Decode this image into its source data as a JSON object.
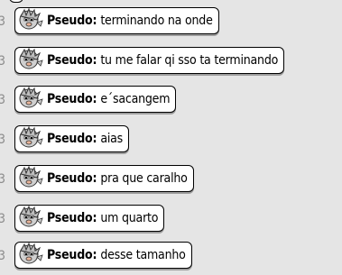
{
  "chat": {
    "messages": [
      {
        "left_mark": "3",
        "sender": "Pseudo:",
        "text": "terminando na onde"
      },
      {
        "left_mark": "3",
        "sender": "Pseudo:",
        "text": "tu me falar qi sso ta terminando"
      },
      {
        "left_mark": "3",
        "sender": "Pseudo:",
        "text": "e´sacangem"
      },
      {
        "left_mark": "3",
        "sender": "Pseudo:",
        "text": "aias"
      },
      {
        "left_mark": "3",
        "sender": "Pseudo:",
        "text": "pra que caralho"
      },
      {
        "left_mark": "3",
        "sender": "Pseudo:",
        "text": "um quarto"
      },
      {
        "left_mark": "3",
        "sender": "Pseudo:",
        "text": "desse tamanho"
      }
    ],
    "avatar_icon": "habbo-avatar-icon",
    "colors": {
      "background": "#e5e5e5",
      "bubble": "#ffffff",
      "border": "#000000",
      "shadow": "#9d9d9d",
      "mark": "#8a8a8a"
    }
  }
}
